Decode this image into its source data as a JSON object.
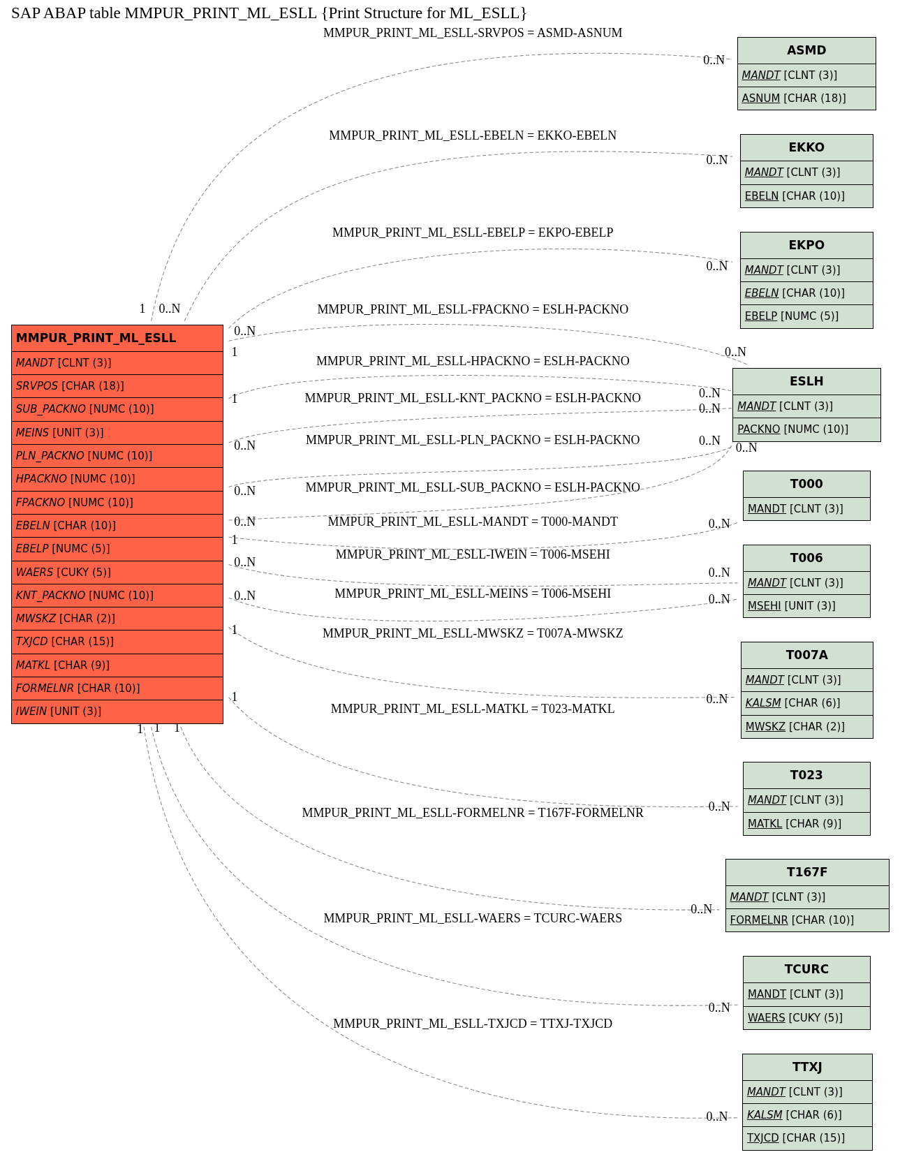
{
  "title": "SAP ABAP table MMPUR_PRINT_ML_ESLL {Print Structure for ML_ESLL}",
  "main_table": {
    "name": "MMPUR_PRINT_ML_ESLL",
    "fields": [
      {
        "name": "MANDT",
        "type": "[CLNT (3)]",
        "key": false,
        "italic": true
      },
      {
        "name": "SRVPOS",
        "type": "[CHAR (18)]",
        "key": false,
        "italic": true
      },
      {
        "name": "SUB_PACKNO",
        "type": "[NUMC (10)]",
        "key": false,
        "italic": true
      },
      {
        "name": "MEINS",
        "type": "[UNIT (3)]",
        "key": false,
        "italic": true
      },
      {
        "name": "PLN_PACKNO",
        "type": "[NUMC (10)]",
        "key": false,
        "italic": true
      },
      {
        "name": "HPACKNO",
        "type": "[NUMC (10)]",
        "key": false,
        "italic": true
      },
      {
        "name": "FPACKNO",
        "type": "[NUMC (10)]",
        "key": false,
        "italic": true
      },
      {
        "name": "EBELN",
        "type": "[CHAR (10)]",
        "key": false,
        "italic": true
      },
      {
        "name": "EBELP",
        "type": "[NUMC (5)]",
        "key": false,
        "italic": true
      },
      {
        "name": "WAERS",
        "type": "[CUKY (5)]",
        "key": false,
        "italic": true
      },
      {
        "name": "KNT_PACKNO",
        "type": "[NUMC (10)]",
        "key": false,
        "italic": true
      },
      {
        "name": "MWSKZ",
        "type": "[CHAR (2)]",
        "key": false,
        "italic": true
      },
      {
        "name": "TXJCD",
        "type": "[CHAR (15)]",
        "key": false,
        "italic": true
      },
      {
        "name": "MATKL",
        "type": "[CHAR (9)]",
        "key": false,
        "italic": true
      },
      {
        "name": "FORMELNR",
        "type": "[CHAR (10)]",
        "key": false,
        "italic": true
      },
      {
        "name": "IWEIN",
        "type": "[UNIT (3)]",
        "key": false,
        "italic": true
      }
    ]
  },
  "related_tables": [
    {
      "name": "ASMD",
      "fields": [
        {
          "name": "MANDT",
          "type": "[CLNT (3)]",
          "key": true,
          "italic": true
        },
        {
          "name": "ASNUM",
          "type": "[CHAR (18)]",
          "key": true,
          "italic": false
        }
      ]
    },
    {
      "name": "EKKO",
      "fields": [
        {
          "name": "MANDT",
          "type": "[CLNT (3)]",
          "key": true,
          "italic": true
        },
        {
          "name": "EBELN",
          "type": "[CHAR (10)]",
          "key": true,
          "italic": false
        }
      ]
    },
    {
      "name": "EKPO",
      "fields": [
        {
          "name": "MANDT",
          "type": "[CLNT (3)]",
          "key": true,
          "italic": true
        },
        {
          "name": "EBELN",
          "type": "[CHAR (10)]",
          "key": true,
          "italic": true
        },
        {
          "name": "EBELP",
          "type": "[NUMC (5)]",
          "key": true,
          "italic": false
        }
      ]
    },
    {
      "name": "ESLH",
      "fields": [
        {
          "name": "MANDT",
          "type": "[CLNT (3)]",
          "key": true,
          "italic": true
        },
        {
          "name": "PACKNO",
          "type": "[NUMC (10)]",
          "key": true,
          "italic": false
        }
      ]
    },
    {
      "name": "T000",
      "fields": [
        {
          "name": "MANDT",
          "type": "[CLNT (3)]",
          "key": true,
          "italic": false
        }
      ]
    },
    {
      "name": "T006",
      "fields": [
        {
          "name": "MANDT",
          "type": "[CLNT (3)]",
          "key": true,
          "italic": true
        },
        {
          "name": "MSEHI",
          "type": "[UNIT (3)]",
          "key": true,
          "italic": false
        }
      ]
    },
    {
      "name": "T007A",
      "fields": [
        {
          "name": "MANDT",
          "type": "[CLNT (3)]",
          "key": true,
          "italic": true
        },
        {
          "name": "KALSM",
          "type": "[CHAR (6)]",
          "key": true,
          "italic": true
        },
        {
          "name": "MWSKZ",
          "type": "[CHAR (2)]",
          "key": true,
          "italic": false
        }
      ]
    },
    {
      "name": "T023",
      "fields": [
        {
          "name": "MANDT",
          "type": "[CLNT (3)]",
          "key": true,
          "italic": true
        },
        {
          "name": "MATKL",
          "type": "[CHAR (9)]",
          "key": true,
          "italic": false
        }
      ]
    },
    {
      "name": "T167F",
      "fields": [
        {
          "name": "MANDT",
          "type": "[CLNT (3)]",
          "key": true,
          "italic": true
        },
        {
          "name": "FORMELNR",
          "type": "[CHAR (10)]",
          "key": true,
          "italic": false
        }
      ]
    },
    {
      "name": "TCURC",
      "fields": [
        {
          "name": "MANDT",
          "type": "[CLNT (3)]",
          "key": true,
          "italic": false
        },
        {
          "name": "WAERS",
          "type": "[CUKY (5)]",
          "key": true,
          "italic": false
        }
      ]
    },
    {
      "name": "TTXJ",
      "fields": [
        {
          "name": "MANDT",
          "type": "[CLNT (3)]",
          "key": true,
          "italic": true
        },
        {
          "name": "KALSM",
          "type": "[CHAR (6)]",
          "key": true,
          "italic": true
        },
        {
          "name": "TXJCD",
          "type": "[CHAR (15)]",
          "key": true,
          "italic": false
        }
      ]
    }
  ],
  "relations": [
    {
      "label": "MMPUR_PRINT_ML_ESLL-SRVPOS = ASMD-ASNUM",
      "from_card": "1",
      "to_card": "0..N"
    },
    {
      "label": "MMPUR_PRINT_ML_ESLL-EBELN = EKKO-EBELN",
      "from_card": "0..N",
      "to_card": "0..N"
    },
    {
      "label": "MMPUR_PRINT_ML_ESLL-EBELP = EKPO-EBELP",
      "from_card": "0..N",
      "to_card": "0..N"
    },
    {
      "label": "MMPUR_PRINT_ML_ESLL-FPACKNO = ESLH-PACKNO",
      "from_card": "1",
      "to_card": "0..N"
    },
    {
      "label": "MMPUR_PRINT_ML_ESLL-HPACKNO = ESLH-PACKNO",
      "from_card": "1",
      "to_card": "0..N"
    },
    {
      "label": "MMPUR_PRINT_ML_ESLL-KNT_PACKNO = ESLH-PACKNO",
      "from_card": "0..N",
      "to_card": "0..N"
    },
    {
      "label": "MMPUR_PRINT_ML_ESLL-PLN_PACKNO = ESLH-PACKNO",
      "from_card": "0..N",
      "to_card": "0..N"
    },
    {
      "label": "MMPUR_PRINT_ML_ESLL-SUB_PACKNO = ESLH-PACKNO",
      "from_card": "0..N",
      "to_card": "0..N"
    },
    {
      "label": "MMPUR_PRINT_ML_ESLL-MANDT = T000-MANDT",
      "from_card": "1",
      "to_card": "0..N"
    },
    {
      "label": "MMPUR_PRINT_ML_ESLL-IWEIN = T006-MSEHI",
      "from_card": "0..N",
      "to_card": "0..N"
    },
    {
      "label": "MMPUR_PRINT_ML_ESLL-MEINS = T006-MSEHI",
      "from_card": "0..N",
      "to_card": "0..N"
    },
    {
      "label": "MMPUR_PRINT_ML_ESLL-MWSKZ = T007A-MWSKZ",
      "from_card": "1",
      "to_card": "0..N"
    },
    {
      "label": "MMPUR_PRINT_ML_ESLL-MATKL = T023-MATKL",
      "from_card": "1",
      "to_card": "0..N"
    },
    {
      "label": "MMPUR_PRINT_ML_ESLL-FORMELNR = T167F-FORMELNR",
      "from_card": "1",
      "to_card": "0..N"
    },
    {
      "label": "MMPUR_PRINT_ML_ESLL-WAERS = TCURC-WAERS",
      "from_card": "1",
      "to_card": "0..N"
    },
    {
      "label": "MMPUR_PRINT_ML_ESLL-TXJCD = TTXJ-TXJCD",
      "from_card": "1",
      "to_card": "0..N"
    }
  ]
}
